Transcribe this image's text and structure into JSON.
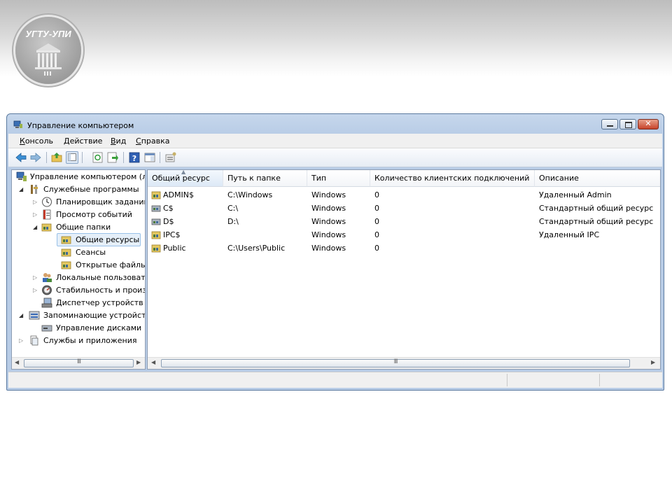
{
  "slide": {
    "logo_text": "УГТУ-УПИ"
  },
  "window": {
    "title": "Управление компьютером",
    "menu": [
      {
        "label": "Консоль",
        "mnemonic": "К",
        "rest": "онсоль"
      },
      {
        "label": "Действие",
        "mnemonic": "Д",
        "rest": "ействие"
      },
      {
        "label": "Вид",
        "mnemonic": "В",
        "rest": "ид"
      },
      {
        "label": "Справка",
        "mnemonic": "С",
        "rest": "правка"
      }
    ],
    "toolbar_icons": [
      "back-arrow-icon",
      "forward-arrow-icon",
      "up-folder-icon",
      "show-hide-tree-icon",
      "refresh-icon",
      "export-list-icon",
      "help-icon",
      "properties-pane-icon",
      "share-properties-icon"
    ]
  },
  "tree": {
    "items": [
      {
        "label": "Управление компьютером (л",
        "icon": "computer-management-icon",
        "expander": ""
      },
      {
        "label": "Служебные программы",
        "icon": "tools-icon",
        "expander": "open"
      },
      {
        "label": "Планировщик заданий",
        "icon": "clock-icon",
        "expander": "closed"
      },
      {
        "label": "Просмотр событий",
        "icon": "event-viewer-icon",
        "expander": "closed"
      },
      {
        "label": "Общие папки",
        "icon": "shared-folder-icon",
        "expander": "open"
      },
      {
        "label": "Общие ресурсы",
        "icon": "shared-folder-icon",
        "expander": ""
      },
      {
        "label": "Сеансы",
        "icon": "shared-folder-icon",
        "expander": ""
      },
      {
        "label": "Открытые файлы",
        "icon": "shared-folder-icon",
        "expander": ""
      },
      {
        "label": "Локальные пользовате",
        "icon": "users-icon",
        "expander": "closed"
      },
      {
        "label": "Стабильность и произ",
        "icon": "performance-icon",
        "expander": "closed"
      },
      {
        "label": "Диспетчер устройств",
        "icon": "device-manager-icon",
        "expander": ""
      },
      {
        "label": "Запоминающие устройст",
        "icon": "storage-icon",
        "expander": "open"
      },
      {
        "label": "Управление дисками",
        "icon": "disk-icon",
        "expander": ""
      },
      {
        "label": "Службы и приложения",
        "icon": "services-icon",
        "expander": "closed"
      }
    ],
    "selected_index": 5,
    "scroll_grip": "III"
  },
  "list": {
    "columns": [
      "Общий ресурс",
      "Путь к папке",
      "Тип",
      "Количество клиентских подключений",
      "Описание"
    ],
    "sorted_column": 0,
    "rows": [
      {
        "name": "ADMIN$",
        "path": "C:\\Windows",
        "type": "Windows",
        "connections": "0",
        "description": "Удаленный Admin"
      },
      {
        "name": "C$",
        "path": "C:\\",
        "type": "Windows",
        "connections": "0",
        "description": "Стандартный общий ресурс"
      },
      {
        "name": "D$",
        "path": "D:\\",
        "type": "Windows",
        "connections": "0",
        "description": "Стандартный общий ресурс"
      },
      {
        "name": "IPC$",
        "path": "",
        "type": "Windows",
        "connections": "0",
        "description": "Удаленный IPC"
      },
      {
        "name": "Public",
        "path": "C:\\Users\\Public",
        "type": "Windows",
        "connections": "0",
        "description": ""
      }
    ],
    "scroll_grip": "III"
  },
  "colors": {
    "window_frame": "#b8cce6",
    "selection": "#e5eff9",
    "share_icon": "#b89a3a"
  }
}
